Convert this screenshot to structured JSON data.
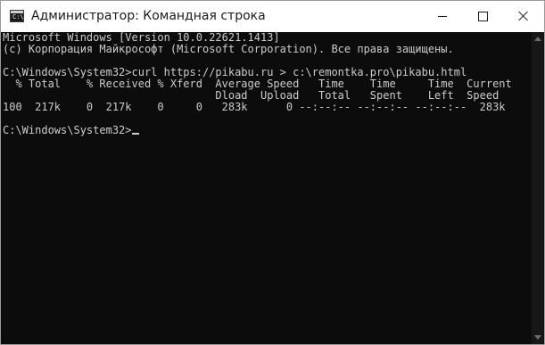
{
  "window": {
    "title": "Администратор: Командная строка",
    "icon": "cmd-icon",
    "buttons": {
      "minimize": "minimize-icon",
      "maximize": "maximize-icon",
      "close": "close-icon"
    }
  },
  "console": {
    "lines": [
      "Microsoft Windows [Version 10.0.22621.1413]",
      "(c) Корпорация Майкрософт (Microsoft Corporation). Все права защищены.",
      "",
      "C:\\Windows\\System32>curl https://pikabu.ru > c:\\remontka.pro\\pikabu.html",
      "  % Total    % Received % Xferd  Average Speed   Time    Time     Time  Current",
      "                                 Dload  Upload   Total   Spent    Left  Speed",
      "100  217k    0  217k    0     0   283k      0 --:--:-- --:--:-- --:--:--  283k",
      "",
      "C:\\Windows\\System32>"
    ]
  },
  "colors": {
    "console_bg": "#0c0c0c",
    "console_text": "#cccccc",
    "titlebar_bg": "#ffffff"
  }
}
